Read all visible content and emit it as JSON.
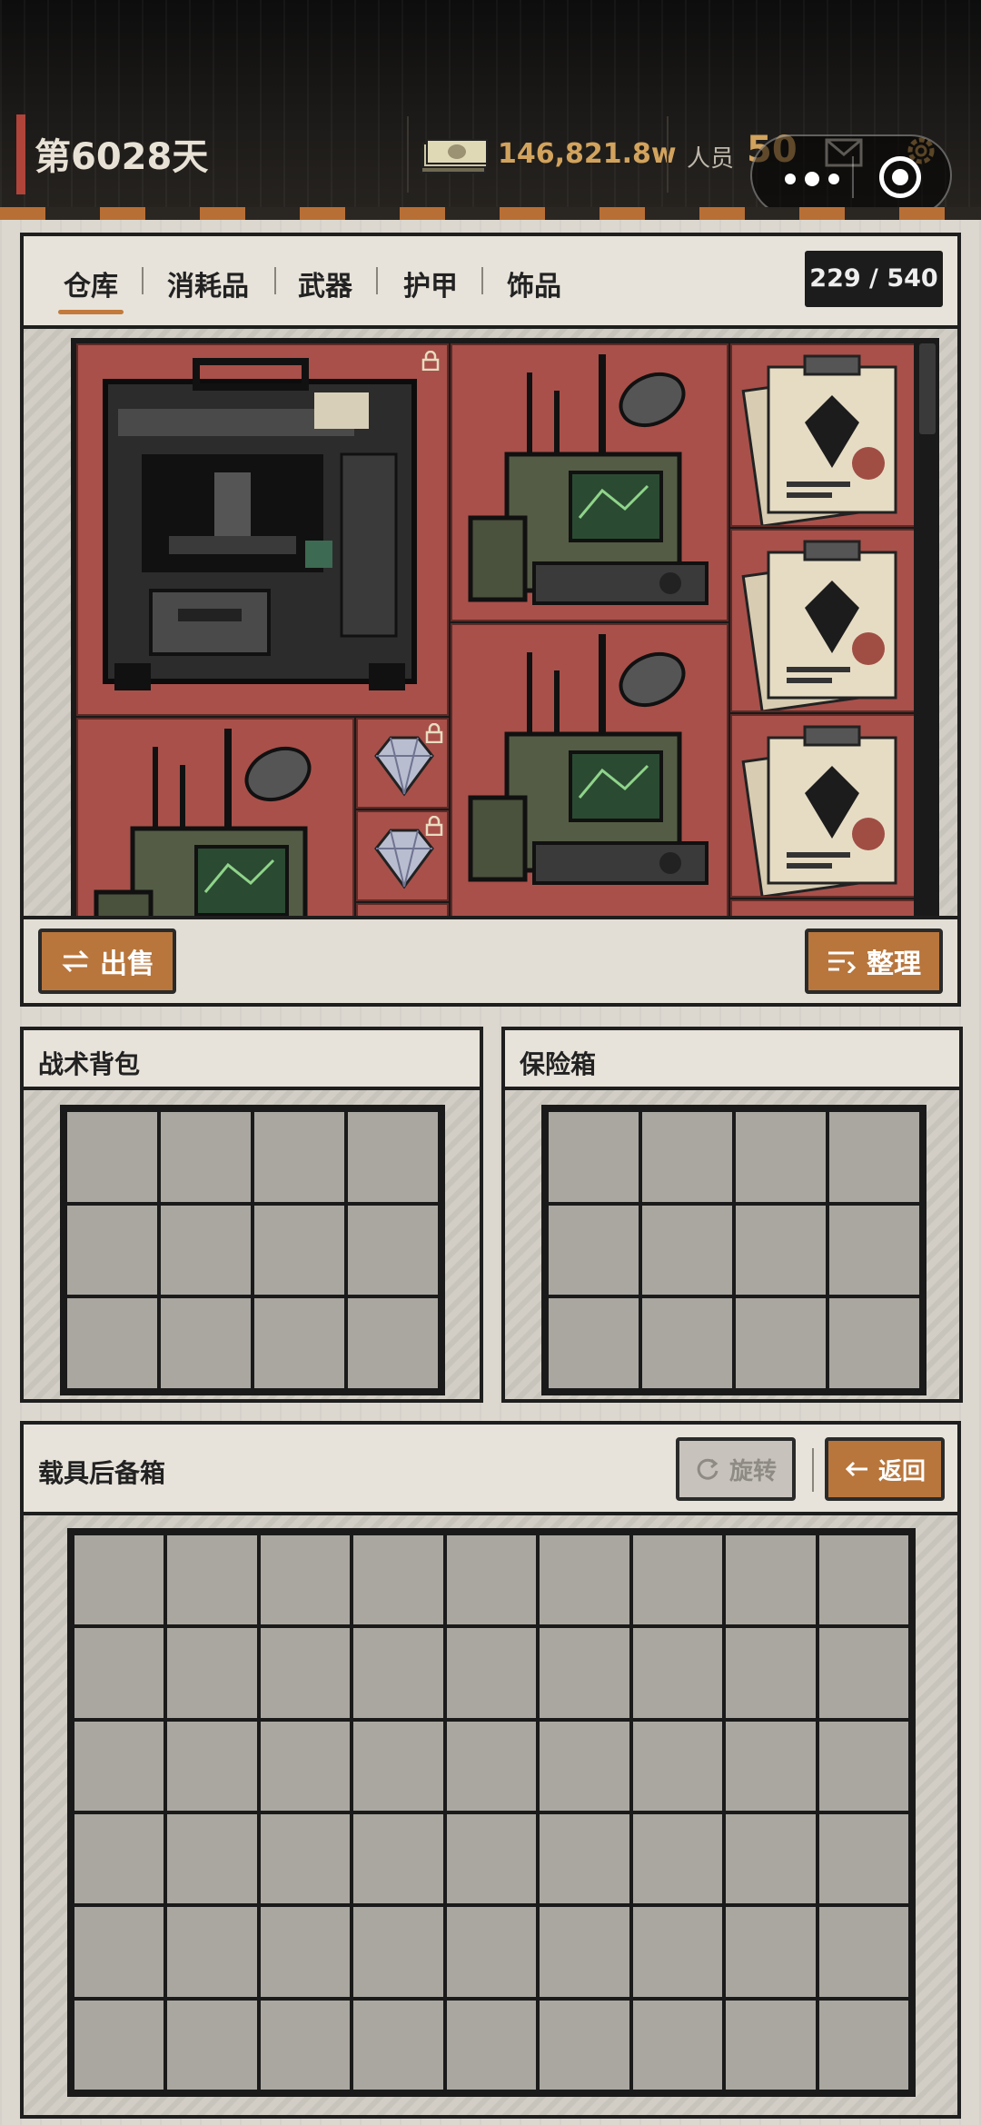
{
  "header": {
    "day_label": "第6028天",
    "money": "146,821.8w",
    "staff_label": "人员",
    "staff_count": "50"
  },
  "warehouse": {
    "tabs": [
      "仓库",
      "消耗品",
      "武器",
      "护甲",
      "饰品"
    ],
    "active_tab": "仓库",
    "capacity": "229 / 540",
    "sell_label": "出售",
    "sort_label": "整理",
    "items": [
      {
        "name": "fabricator-machine",
        "locked": true
      },
      {
        "name": "radio-station"
      },
      {
        "name": "intel-documents"
      },
      {
        "name": "intel-documents"
      },
      {
        "name": "radio-station"
      },
      {
        "name": "intel-documents"
      },
      {
        "name": "radio-station"
      },
      {
        "name": "diamond",
        "locked": true
      },
      {
        "name": "diamond",
        "locked": true
      }
    ]
  },
  "backpack": {
    "title": "战术背包",
    "rows": 3,
    "cols": 4
  },
  "safebox": {
    "title": "保险箱",
    "rows": 3,
    "cols": 4
  },
  "trunk": {
    "title": "载具后备箱",
    "rotate_label": "旋转",
    "back_label": "返回",
    "rows": 6,
    "cols": 9
  },
  "colors": {
    "accent": "#b8763c",
    "money": "#d2a35d",
    "item_bg": "#a9504a",
    "cell": "#aaa7a1"
  }
}
